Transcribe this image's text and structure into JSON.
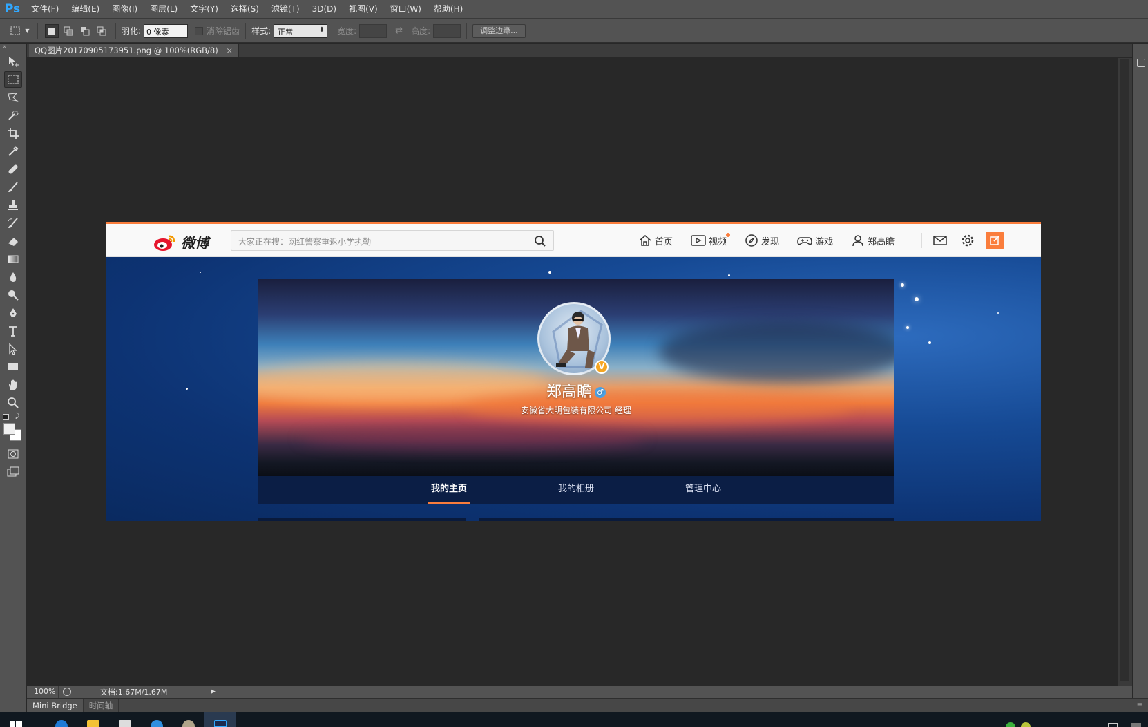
{
  "app": {
    "logo": "Ps",
    "menu": [
      "文件(F)",
      "编辑(E)",
      "图像(I)",
      "图层(L)",
      "文字(Y)",
      "选择(S)",
      "滤镜(T)",
      "3D(D)",
      "视图(V)",
      "窗口(W)",
      "帮助(H)"
    ]
  },
  "options": {
    "feather_label": "羽化:",
    "feather_value": "0 像素",
    "antialias_label": "消除锯齿",
    "style_label": "样式:",
    "style_value": "正常",
    "width_label": "宽度:",
    "height_label": "高度:",
    "refine_button": "调整边缘..."
  },
  "document": {
    "tab_title": "QQ图片20170905173951.png @ 100%(RGB/8)",
    "tab_close": "×"
  },
  "status": {
    "zoom": "100%",
    "doc_size": "文档:1.67M/1.67M"
  },
  "bottom_panel": {
    "tabs": [
      "Mini Bridge",
      "时间轴"
    ]
  },
  "weibo": {
    "logo_text": "微博",
    "search_placeholder": "大家正在搜：网红警察重返小学执勤",
    "nav": [
      {
        "label": "首页",
        "icon": "home-icon"
      },
      {
        "label": "视频",
        "icon": "video-icon"
      },
      {
        "label": "发现",
        "icon": "compass-icon"
      },
      {
        "label": "游戏",
        "icon": "gamepad-icon"
      },
      {
        "label": "郑高瞻",
        "icon": "user-icon"
      }
    ],
    "profile": {
      "name": "郑高瞻",
      "verified_badge": "V",
      "gender_symbol": "♂",
      "description": "安徽省大明包装有限公司 经理"
    },
    "tabs": [
      "我的主页",
      "我的相册",
      "管理中心"
    ],
    "active_tab": 0,
    "accent_color": "#fa7d3c"
  }
}
